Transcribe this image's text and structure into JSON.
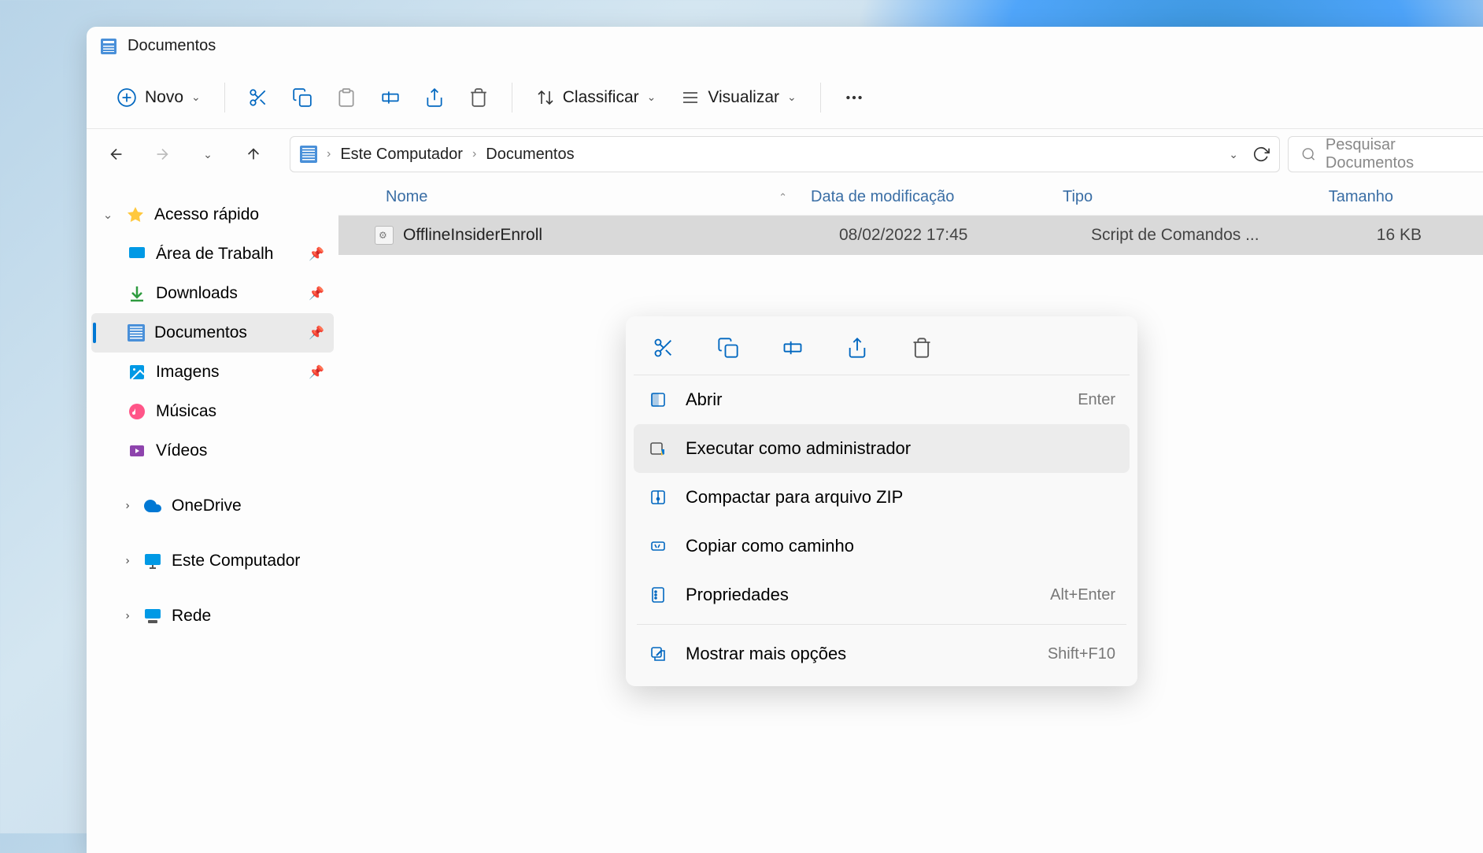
{
  "window": {
    "title": "Documentos"
  },
  "toolbar": {
    "new_label": "Novo",
    "sort_label": "Classificar",
    "view_label": "Visualizar"
  },
  "breadcrumb": {
    "root": "Este Computador",
    "current": "Documentos"
  },
  "search": {
    "placeholder": "Pesquisar Documentos"
  },
  "columns": {
    "name": "Nome",
    "date": "Data de modificação",
    "type": "Tipo",
    "size": "Tamanho"
  },
  "sidebar": {
    "quick_access": "Acesso rápido",
    "desktop": "Área de Trabalho",
    "downloads": "Downloads",
    "documents": "Documentos",
    "pictures": "Imagens",
    "music": "Músicas",
    "videos": "Vídeos",
    "onedrive": "OneDrive",
    "this_pc": "Este Computador",
    "network": "Rede"
  },
  "files": [
    {
      "name": "OfflineInsiderEnroll",
      "date": "08/02/2022 17:45",
      "type": "Script de Comandos ...",
      "size": "16 KB"
    }
  ],
  "context_menu": {
    "open": "Abrir",
    "open_shortcut": "Enter",
    "run_admin": "Executar como administrador",
    "zip": "Compactar para arquivo ZIP",
    "copy_path": "Copiar como caminho",
    "properties": "Propriedades",
    "properties_shortcut": "Alt+Enter",
    "more": "Mostrar mais opções",
    "more_shortcut": "Shift+F10"
  }
}
